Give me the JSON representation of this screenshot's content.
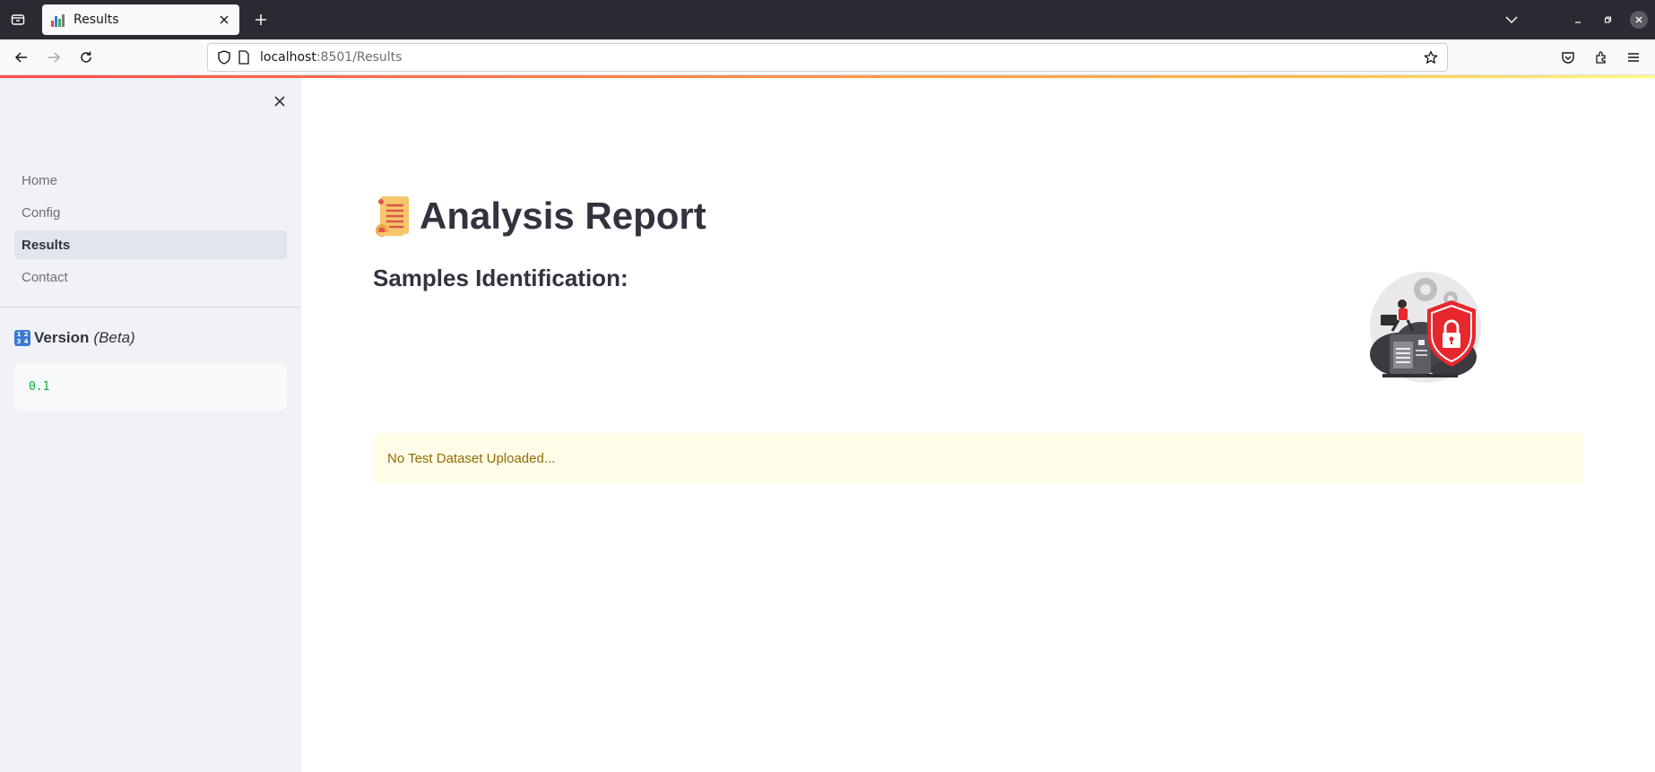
{
  "browser": {
    "tab_title": "Results",
    "url_host": "localhost",
    "url_path": ":8501/Results"
  },
  "sidebar": {
    "nav_items": [
      {
        "label": "Home",
        "active": false
      },
      {
        "label": "Config",
        "active": false
      },
      {
        "label": "Results",
        "active": true
      },
      {
        "label": "Contact",
        "active": false
      }
    ],
    "version_label": "Version",
    "version_tag": "(Beta)",
    "version_value": "0.1",
    "numbers_icon": [
      "1",
      "2",
      "3",
      "4"
    ]
  },
  "main": {
    "title": "Analysis Report",
    "subtitle": "Samples Identification:",
    "warning_text": "No Test Dataset Uploaded..."
  },
  "colors": {
    "accent": "#ff4b4b",
    "sidebar_bg": "#f0f2f6",
    "warning_bg": "#fffce7",
    "warning_text": "#926c05",
    "code_text": "#09ab3b"
  }
}
